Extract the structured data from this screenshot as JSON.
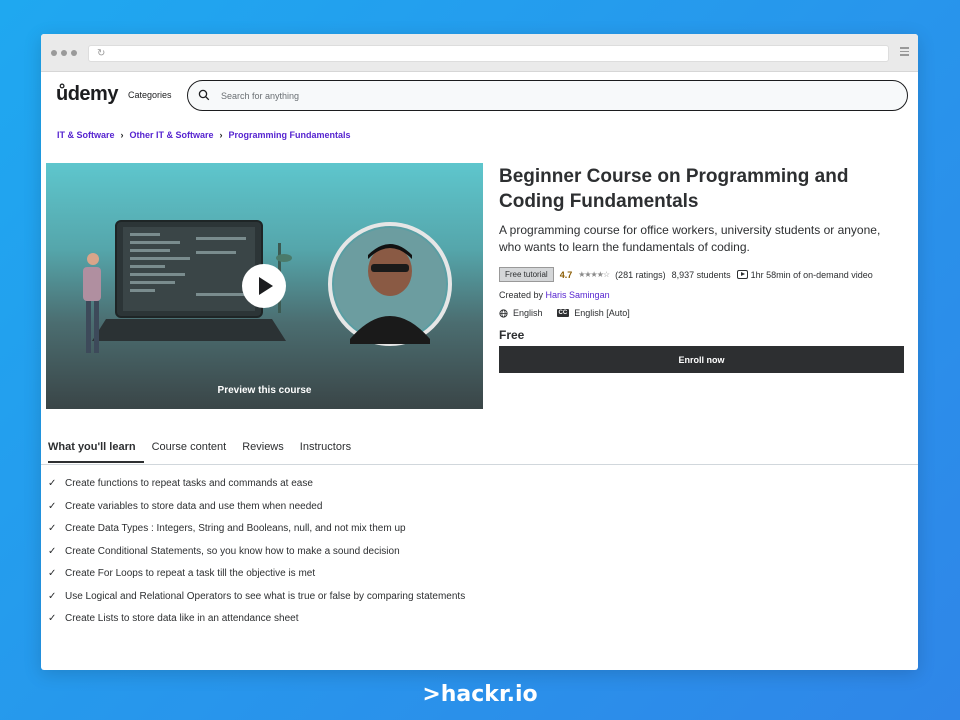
{
  "browser": {},
  "header": {
    "logo": "ůdemy",
    "categories_label": "Categories",
    "search_placeholder": "Search for anything"
  },
  "breadcrumbs": [
    "IT & Software",
    "Other IT & Software",
    "Programming Fundamentals"
  ],
  "preview": {
    "label": "Preview this course"
  },
  "course": {
    "title": "Beginner Course on Programming and Coding Fundamentals",
    "subtitle": "A programming course for office workers, university students or anyone, who wants to learn the fundamentals of coding.",
    "badge": "Free tutorial",
    "rating": "4.7",
    "ratings_count": "(281 ratings)",
    "students": "8,937 students",
    "video": "1hr 58min of on-demand video",
    "created_by_label": "Created by",
    "instructor": "Haris Samingan",
    "language": "English",
    "captions": "English [Auto]",
    "price": "Free",
    "enroll_label": "Enroll now"
  },
  "tabs": [
    "What you'll learn",
    "Course content",
    "Reviews",
    "Instructors"
  ],
  "learn_items": [
    "Create functions to repeat tasks and commands at ease",
    "Create variables to store data and use them when needed",
    "Create Data Types : Integers, String and Booleans, null, and not mix them up",
    "Create Conditional Statements, so you know how to make a sound decision",
    "Create For Loops to repeat a task till the objective is met",
    "Use Logical and Relational Operators to see what is true or false by comparing statements",
    "Create Lists to store data like in an attendance sheet"
  ],
  "footer_brand": ">hackr.io",
  "colors": {
    "background": "#1fa8f0",
    "accent_purple": "#5624d0",
    "dark": "#2d2f31",
    "rating": "#8a5b00"
  }
}
